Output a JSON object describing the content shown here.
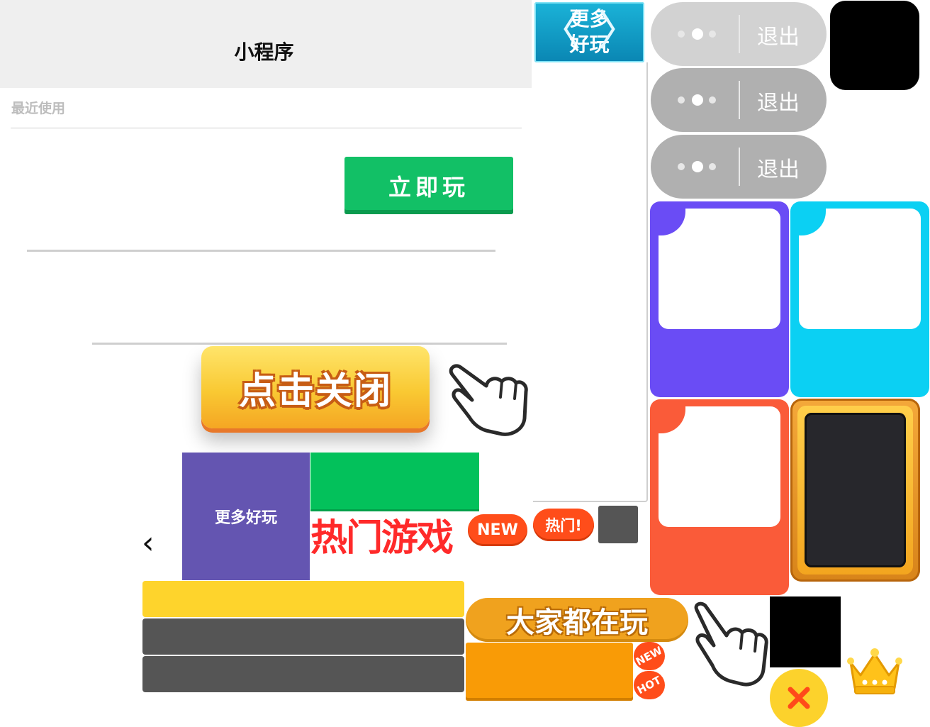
{
  "header": {
    "title": "小程序"
  },
  "recent": {
    "label": "最近使用"
  },
  "buttons": {
    "play_now": "立即玩",
    "click_close": "点击关闭",
    "more_fun_banner": "更多\n好玩",
    "more_fun_tile": "更多好玩",
    "everyone_playing": "大家都在玩"
  },
  "capsules": [
    {
      "exit_label": "退出"
    },
    {
      "exit_label": "退出"
    },
    {
      "exit_label": "退出"
    }
  ],
  "labels": {
    "hot_games": "热门游戏",
    "new_badge": "NEW",
    "hot_badge": "热门!",
    "tag_new": "NEW",
    "tag_hot": "HOT"
  },
  "icons": {
    "back": "chevron-left-icon",
    "banner_left": "chevron-left-icon",
    "banner_right": "chevron-right-icon",
    "hand": "pointing-hand-icon",
    "crown": "crown-icon",
    "close": "close-icon"
  },
  "colors": {
    "play_green": "#12c066",
    "purple_card": "#6a4cf5",
    "cyan_card": "#0bd0f3",
    "orange_card": "#fa5b39",
    "yellow_bar": "#fed42c",
    "dark_bar": "#555555"
  }
}
